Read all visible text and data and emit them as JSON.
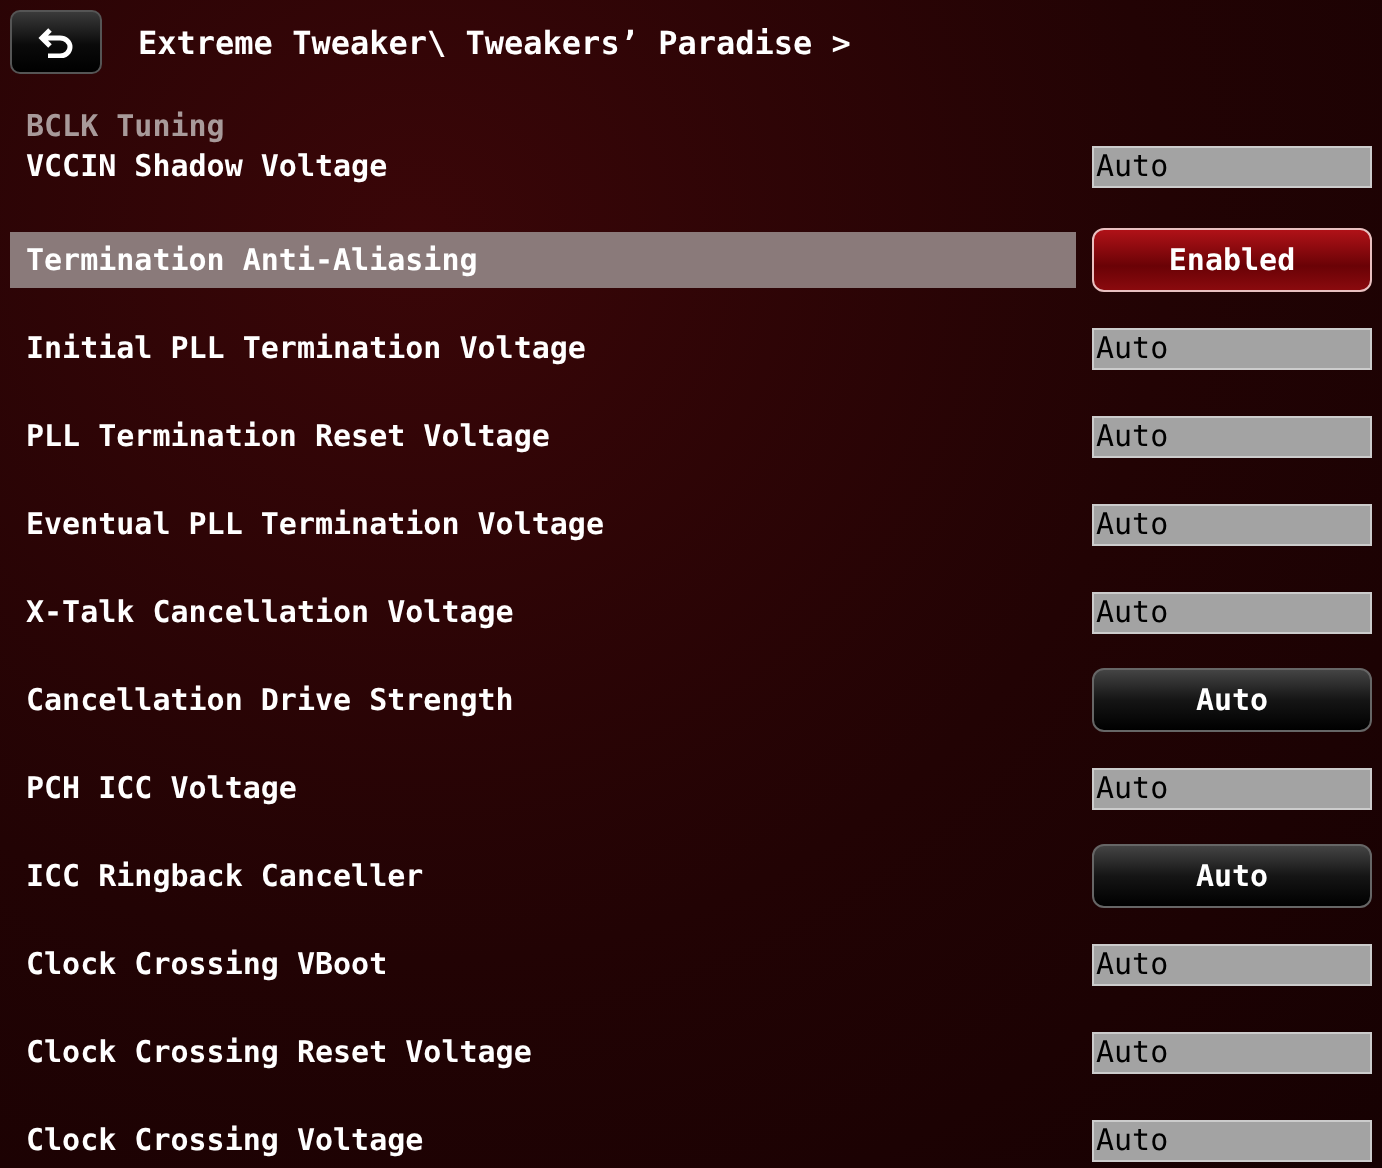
{
  "header": {
    "title": "Extreme Tweaker\\ Tweakers’ Paradise >"
  },
  "section": {
    "heading": "BCLK Tuning",
    "first": {
      "label": "VCCIN Shadow Voltage",
      "kind": "field",
      "value": "Auto",
      "selected": false
    }
  },
  "settings": [
    {
      "label": "Termination Anti-Aliasing",
      "kind": "dropdown",
      "value": "Enabled",
      "selected": true
    },
    {
      "label": "Initial PLL Termination Voltage",
      "kind": "field",
      "value": "Auto",
      "selected": false
    },
    {
      "label": "PLL Termination Reset Voltage",
      "kind": "field",
      "value": "Auto",
      "selected": false
    },
    {
      "label": "Eventual PLL Termination Voltage",
      "kind": "field",
      "value": "Auto",
      "selected": false
    },
    {
      "label": "X-Talk Cancellation Voltage",
      "kind": "field",
      "value": "Auto",
      "selected": false
    },
    {
      "label": "Cancellation Drive Strength",
      "kind": "dropdown",
      "value": "Auto",
      "selected": false
    },
    {
      "label": "PCH ICC Voltage",
      "kind": "field",
      "value": "Auto",
      "selected": false
    },
    {
      "label": "ICC Ringback Canceller",
      "kind": "dropdown",
      "value": "Auto",
      "selected": false
    },
    {
      "label": "Clock Crossing VBoot",
      "kind": "field",
      "value": "Auto",
      "selected": false
    },
    {
      "label": "Clock Crossing Reset Voltage",
      "kind": "field",
      "value": "Auto",
      "selected": false
    },
    {
      "label": "Clock Crossing Voltage",
      "kind": "field",
      "value": "Auto",
      "selected": false
    }
  ]
}
